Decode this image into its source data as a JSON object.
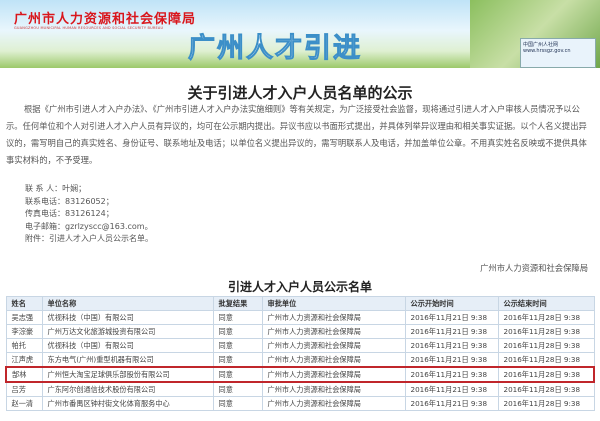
{
  "header": {
    "org_name": "广州市人力资源和社会保障局",
    "org_name_en": "GUANGZHOU MUNICIPAL HUMAN RESOURCES AND SOCIAL SECURITY BUREAU",
    "slogan": "广州人才引进",
    "logo_text": "中国广州人社网",
    "logo_url": "www.hrssgz.gov.cn"
  },
  "notice": {
    "title": "关于引进人才入户人员名单的公示",
    "body": "根据《广州市引进人才入户办法》、《广州市引进人才入户办法实施细则》等有关规定，为广泛接受社会监督，现将通过引进人才入户审核人员情况予以公示。任何单位和个人对引进人才入户人员有异议的，均可在公示期内提出。异议书应以书面形式提出，并具体列举异议理由和相关事实证据。以个人名义提出异议的，需写明自己的真实姓名、身份证号、联系地址及电话；以单位名义提出异议的，需写明联系人及电话，并加盖单位公章。不用真实姓名反映或不提供具体事实材料的，不予受理。",
    "contacts": [
      "联 系 人：叶娴；",
      "联系电话：83126052；",
      "传真电话：83126124；",
      "电子邮箱：gzrlzyscc@163.com。",
      "附件：引进人才入户人员公示名单。"
    ],
    "signature": "广州市人力资源和社会保障局"
  },
  "table": {
    "title": "引进人才入户人员公示名单",
    "headers": [
      "姓名",
      "单位名称",
      "批复结果",
      "审批单位",
      "公示开始时间",
      "公示结束时间"
    ],
    "rows": [
      [
        "吴志强",
        "优视科技（中国）有限公司",
        "同意",
        "广州市人力资源和社会保障局",
        "2016年11月21日 9:38",
        "2016年11月28日 9:38"
      ],
      [
        "李淙豪",
        "广州万达文化旅游城投资有限公司",
        "同意",
        "广州市人力资源和社会保障局",
        "2016年11月21日 9:38",
        "2016年11月28日 9:38"
      ],
      [
        "帕托",
        "优视科技（中国）有限公司",
        "同意",
        "广州市人力资源和社会保障局",
        "2016年11月21日 9:38",
        "2016年11月28日 9:38"
      ],
      [
        "江声虎",
        "东方电气(广州)重型机器有限公司",
        "同意",
        "广州市人力资源和社会保障局",
        "2016年11月21日 9:38",
        "2016年11月28日 9:38"
      ],
      [
        "郜林",
        "广州恒大淘宝足球俱乐部股份有限公司",
        "同意",
        "广州市人力资源和社会保障局",
        "2016年11月21日 9:38",
        "2016年11月28日 9:38"
      ],
      [
        "吕芳",
        "广东阿尔创通信技术股份有限公司",
        "同意",
        "广州市人力资源和社会保障局",
        "2016年11月21日 9:38",
        "2016年11月28日 9:38"
      ],
      [
        "赵一清",
        "广州市番禺区钟村街文化体育服务中心",
        "同意",
        "广州市人力资源和社会保障局",
        "2016年11月21日 9:38",
        "2016年11月28日 9:38"
      ]
    ],
    "highlight_row": 4,
    "highlight_color": "#c0262b"
  }
}
